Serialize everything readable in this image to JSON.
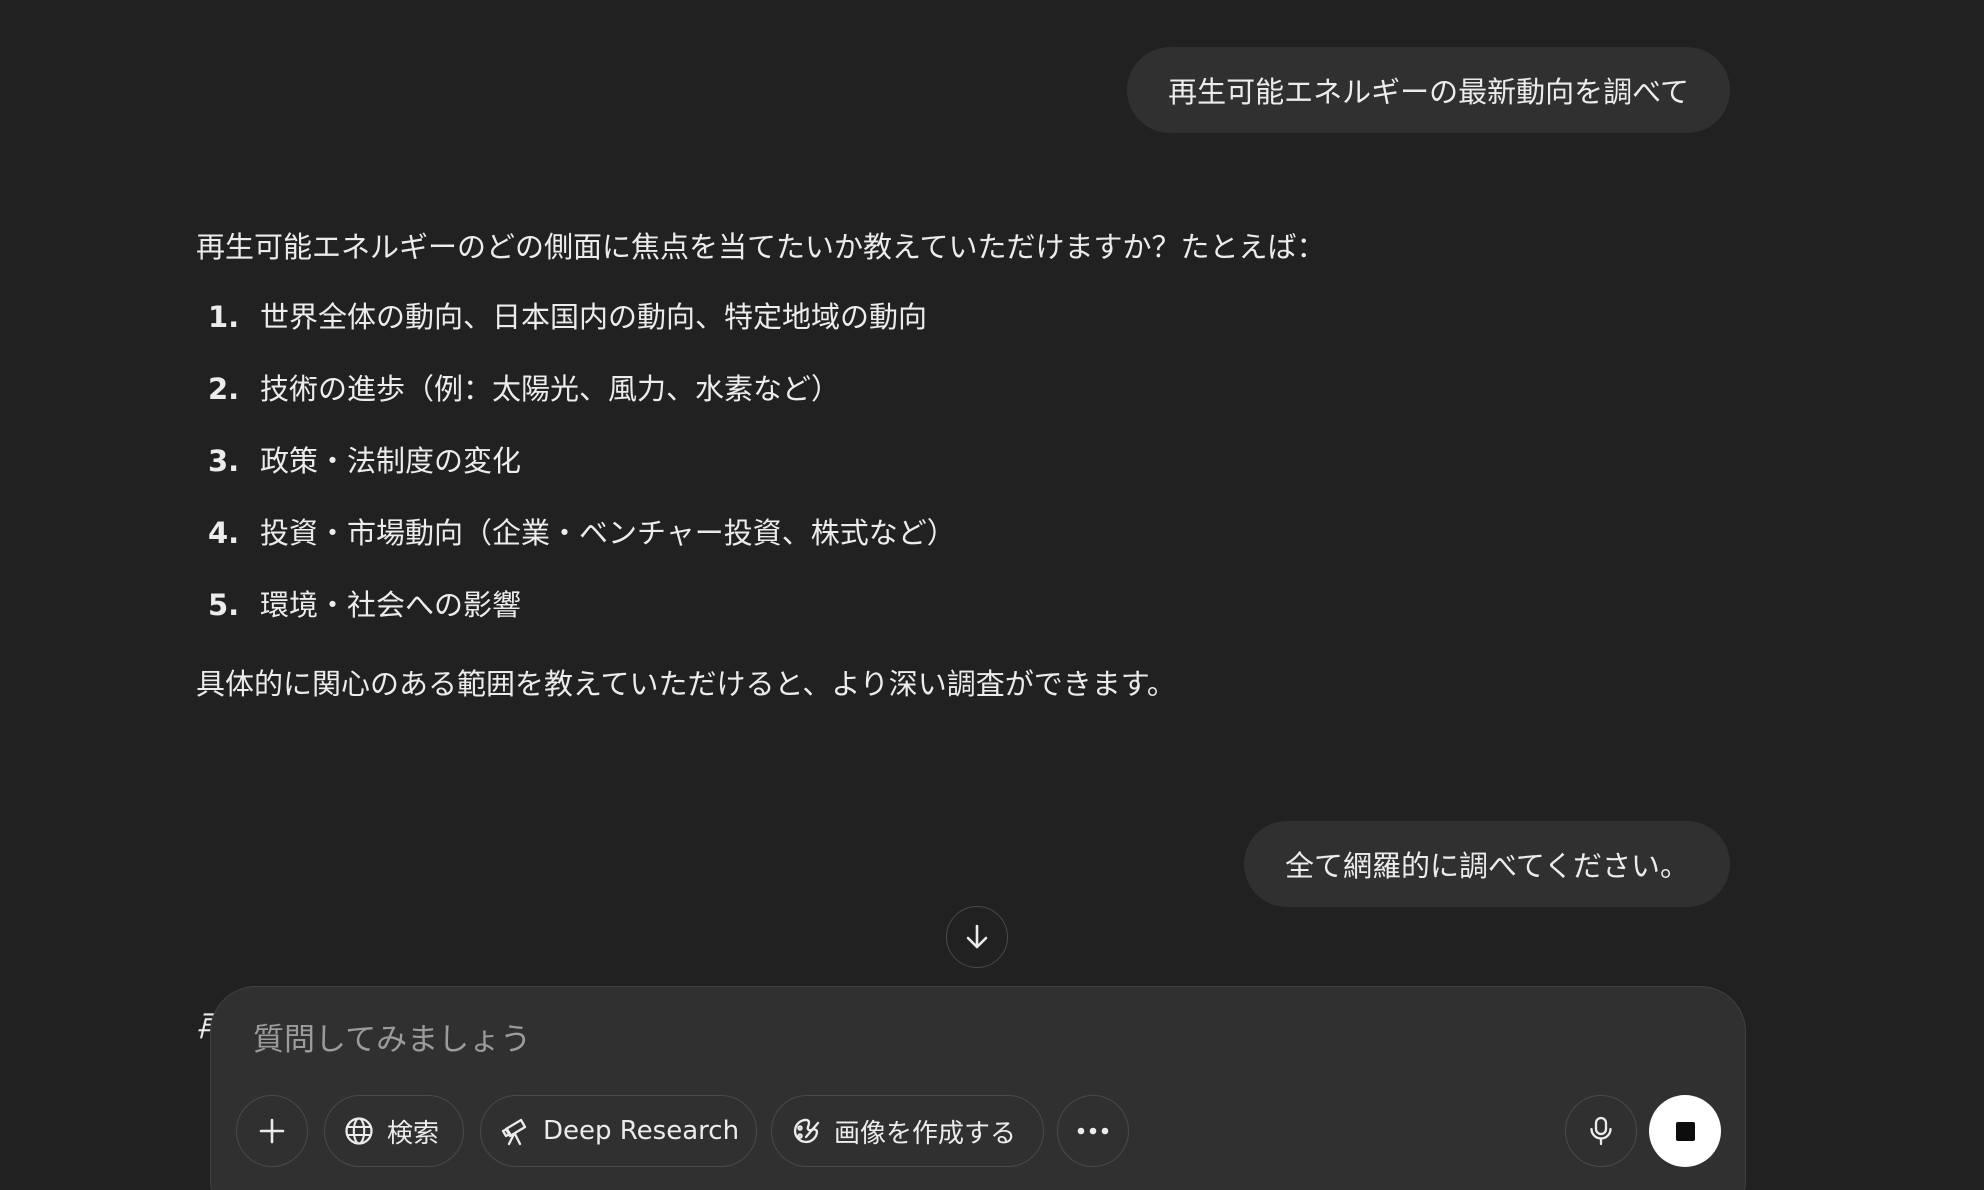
{
  "conversation": {
    "user_message_1": "再生可能エネルギーの最新動向を調べて",
    "assistant": {
      "intro": "再生可能エネルギーのどの側面に焦点を当てたいか教えていただけますか？たとえば：",
      "items": [
        {
          "number": "1.",
          "text": "世界全体の動向、日本国内の動向、特定地域の動向"
        },
        {
          "number": "2.",
          "text": "技術の進歩（例：太陽光、風力、水素など）"
        },
        {
          "number": "3.",
          "text": "政策・法制度の変化"
        },
        {
          "number": "4.",
          "text": "投資・市場動向（企業・ベンチャー投資、株式など）"
        },
        {
          "number": "5.",
          "text": "環境・社会への影響"
        }
      ],
      "outro": "具体的に関心のある範囲を教えていただけると、より深い調査ができます。"
    },
    "user_message_2": "全て網羅的に調べてください。",
    "partial_text": "再"
  },
  "composer": {
    "placeholder": "質問してみましょう",
    "buttons": {
      "add": "add-icon",
      "search_label": "検索",
      "deep_research_label": "Deep Research",
      "create_image_label": "画像を作成する",
      "more": "more-icon",
      "mic": "microphone-icon",
      "stop": "stop-icon"
    }
  },
  "colors": {
    "background": "#212121",
    "bubble": "#303030",
    "text": "#ececec",
    "placeholder": "#9b9b9b",
    "stop_button": "#ffffff"
  }
}
